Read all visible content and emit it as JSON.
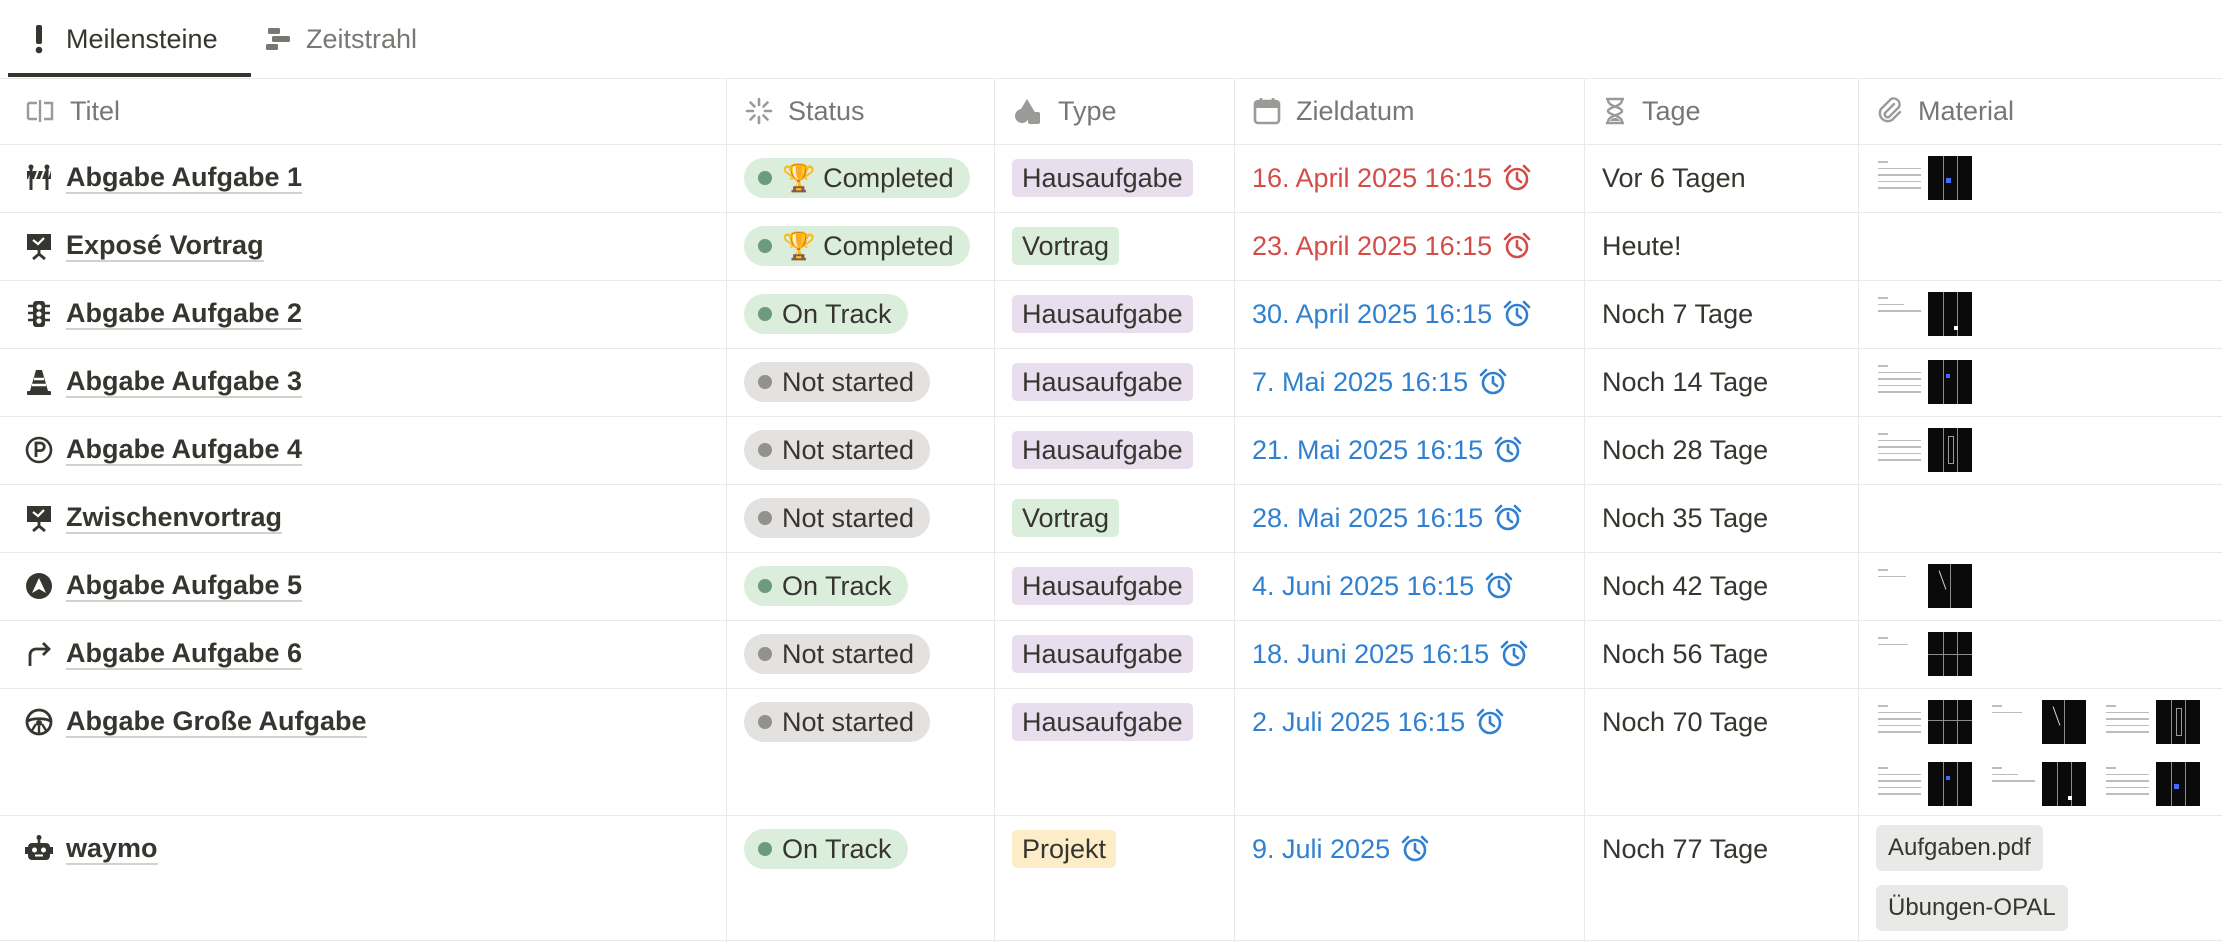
{
  "tabs": [
    {
      "label": "Meilensteine",
      "icon": "exclamation-icon",
      "active": true
    },
    {
      "label": "Zeitstrahl",
      "icon": "timeline-icon",
      "active": false
    }
  ],
  "columns": {
    "title": "Titel",
    "status": "Status",
    "type": "Type",
    "date": "Zieldatum",
    "days": "Tage",
    "material": "Material"
  },
  "colors": {
    "overdue": "#d44c47",
    "upcoming": "#2f80d0",
    "completed_pill": "#dbeddb",
    "ontrack_pill": "#dbeddb",
    "notstarted_pill": "#e3e2e0",
    "hausaufgabe_tag": "#e8deee",
    "vortrag_tag": "#dbeddb",
    "projekt_tag": "#fdecc8"
  },
  "rows": [
    {
      "title": "Abgabe Aufgabe 1",
      "icon": "barrier-icon",
      "status": "🏆 Completed",
      "status_kind": "completed",
      "type": "Hausaufgabe",
      "date": "16. April 2025 16:15",
      "date_kind": "overdue",
      "days": "Vor 6 Tagen",
      "material_icon": "pdf-thumbnail"
    },
    {
      "title": "Exposé Vortrag",
      "icon": "presentation-icon",
      "status": "🏆 Completed",
      "status_kind": "completed",
      "type": "Vortrag",
      "date": "23. April 2025 16:15",
      "date_kind": "overdue",
      "days": "Heute!"
    },
    {
      "title": "Abgabe Aufgabe 2",
      "icon": "traffic-light-icon",
      "status": "On Track",
      "status_kind": "ontrack",
      "type": "Hausaufgabe",
      "date": "30. April 2025 16:15",
      "date_kind": "upcoming",
      "days": "Noch 7 Tage",
      "material_icon": "pdf-thumbnail"
    },
    {
      "title": "Abgabe Aufgabe 3",
      "icon": "traffic-cone-icon",
      "status": "Not started",
      "status_kind": "notstarted",
      "type": "Hausaufgabe",
      "date": "7. Mai 2025 16:15",
      "date_kind": "upcoming",
      "days": "Noch 14 Tage",
      "material_icon": "pdf-thumbnail"
    },
    {
      "title": "Abgabe Aufgabe 4",
      "icon": "parking-icon",
      "status": "Not started",
      "status_kind": "notstarted",
      "type": "Hausaufgabe",
      "date": "21. Mai 2025 16:15",
      "date_kind": "upcoming",
      "days": "Noch 28 Tage",
      "material_icon": "pdf-thumbnail"
    },
    {
      "title": "Zwischenvortrag",
      "icon": "presentation-icon",
      "status": "Not started",
      "status_kind": "notstarted",
      "type": "Vortrag",
      "date": "28. Mai 2025 16:15",
      "date_kind": "upcoming",
      "days": "Noch 35 Tage"
    },
    {
      "title": "Abgabe Aufgabe 5",
      "icon": "navigation-arrow-icon",
      "status": "On Track",
      "status_kind": "ontrack",
      "type": "Hausaufgabe",
      "date": "4. Juni 2025 16:15",
      "date_kind": "upcoming",
      "days": "Noch 42 Tage",
      "material_icon": "pdf-thumbnail"
    },
    {
      "title": "Abgabe Aufgabe 6",
      "icon": "turn-right-arrow-icon",
      "status": "Not started",
      "status_kind": "notstarted",
      "type": "Hausaufgabe",
      "date": "18. Juni 2025 16:15",
      "date_kind": "upcoming",
      "days": "Noch 56 Tage",
      "material_icon": "pdf-thumbnail"
    },
    {
      "title": "Abgabe Große Aufgabe",
      "icon": "steering-wheel-icon",
      "status": "Not started",
      "status_kind": "notstarted",
      "type": "Hausaufgabe",
      "date": "2. Juli 2025 16:15",
      "date_kind": "upcoming",
      "days": "Noch 70 Tage",
      "material_icon": "pdf-thumbnail"
    },
    {
      "title": "waymo",
      "icon": "robot-icon",
      "status": "On Track",
      "status_kind": "ontrack",
      "type": "Projekt",
      "date": "9. Juli 2025",
      "date_kind": "upcoming",
      "days": "Noch 77 Tage",
      "files": [
        "Aufgaben.pdf",
        "Übungen-OPAL"
      ]
    }
  ]
}
